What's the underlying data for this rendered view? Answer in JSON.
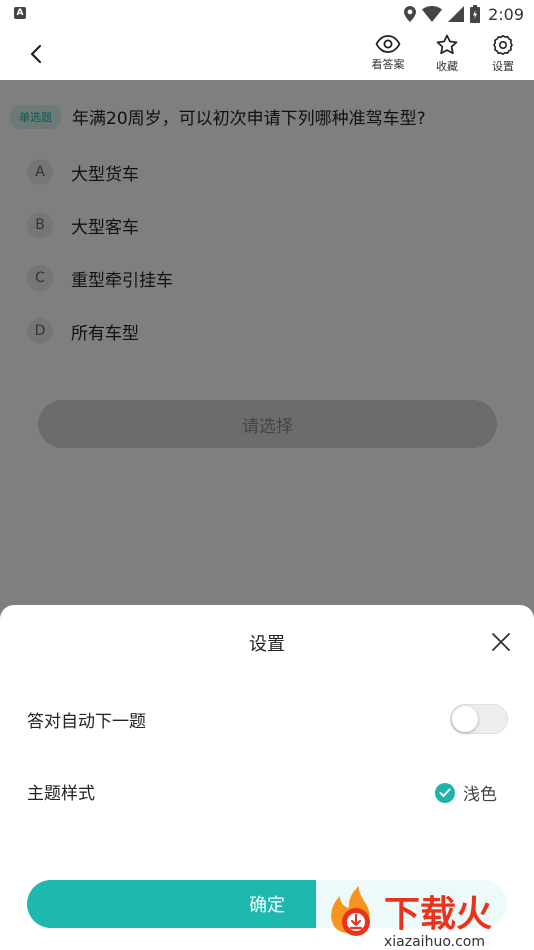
{
  "status_bar": {
    "notification_glyph": "A",
    "time": "2:09",
    "icons": [
      "location-icon",
      "wifi-icon",
      "signal-icon",
      "battery-icon"
    ]
  },
  "header": {
    "actions": [
      {
        "label": "看答案",
        "icon": "eye-icon"
      },
      {
        "label": "收藏",
        "icon": "star-icon"
      },
      {
        "label": "设置",
        "icon": "gear-icon"
      }
    ]
  },
  "question": {
    "type_tag": "单选题",
    "text": "年满20周岁，可以初次申请下列哪种准驾车型?",
    "options": [
      {
        "letter": "A",
        "text": "大型货车"
      },
      {
        "letter": "B",
        "text": "大型客车"
      },
      {
        "letter": "C",
        "text": "重型牵引挂车"
      },
      {
        "letter": "D",
        "text": "所有车型"
      }
    ],
    "select_label": "请选择"
  },
  "settings_sheet": {
    "title": "设置",
    "auto_next_label": "答对自动下一题",
    "auto_next_enabled": false,
    "theme_label": "主题样式",
    "theme_option": "浅色",
    "confirm_label": "确定"
  },
  "watermark": {
    "brand": "下载火",
    "url": "xiazaihuo.com"
  },
  "colors": {
    "accent": "#1fb8ae",
    "tag_bg": "#d9f2ef",
    "watermark_red": "#e8341c",
    "watermark_orange": "#f7941d"
  }
}
